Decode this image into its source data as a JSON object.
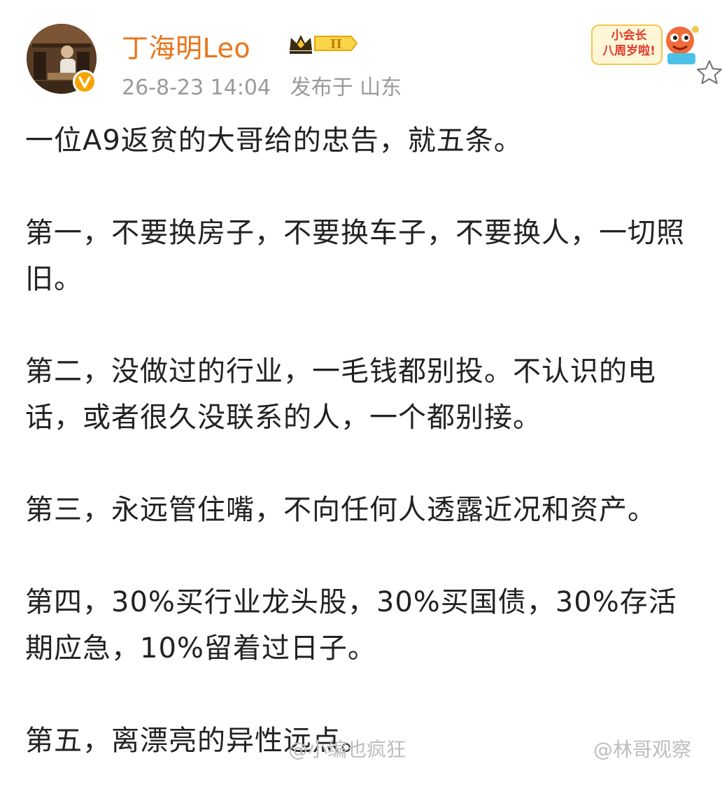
{
  "header": {
    "user_name": "丁海明Leo",
    "vip_level": "II",
    "post_time": "26-8-23 14:04",
    "post_location": "发布于 山东",
    "sticker_line1": "小会长",
    "sticker_line2": "八周岁啦!",
    "avatar_icon": "avatar",
    "verified_icon": "verified-v-icon",
    "favorite_icon": "star-outline-icon"
  },
  "post": {
    "paragraphs": [
      "一位A9返贫的大哥给的忠告，就五条。",
      "第一，不要换房子，不要换车子，不要换人，一切照旧。",
      "第二，没做过的行业，一毛钱都别投。不认识的电话，或者很久没联系的人，一个都别接。",
      "第三，永远管住嘴，不向任何人透露近况和资产。",
      "第四，30%买行业龙头股，30%买国债，30%存活期应急，10%留着过日子。",
      "第五，离漂亮的异性远点。"
    ]
  },
  "watermarks": {
    "left": "@小编也疯狂",
    "right": "@林哥观察"
  },
  "colors": {
    "name_orange": "#e8751a",
    "meta_gray": "#9a9a9a",
    "badge_gold": "#f7a400"
  }
}
